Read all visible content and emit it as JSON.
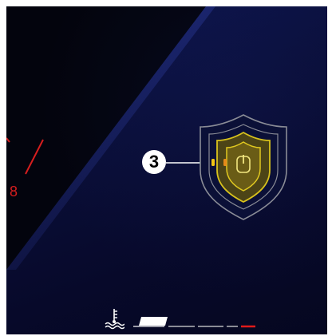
{
  "callout": {
    "label": "3"
  },
  "gauge": {
    "number": "8"
  },
  "icons": {
    "shield": "shield-power-icon",
    "temperature": "coolant-temperature-icon",
    "callout_marker": "callout-badge"
  },
  "coolant_gauge": {
    "segments": 6,
    "level_segments": 1,
    "warning_segment_color": "#e01a1a"
  },
  "colors": {
    "shield_outline": "#8a8c96",
    "shield_inner": "#d8c21c",
    "indicator_left": "#f2c514",
    "indicator_right": "#e58a19",
    "leader_dot": "#18d39a",
    "gauge_red": "#d61e1e"
  }
}
